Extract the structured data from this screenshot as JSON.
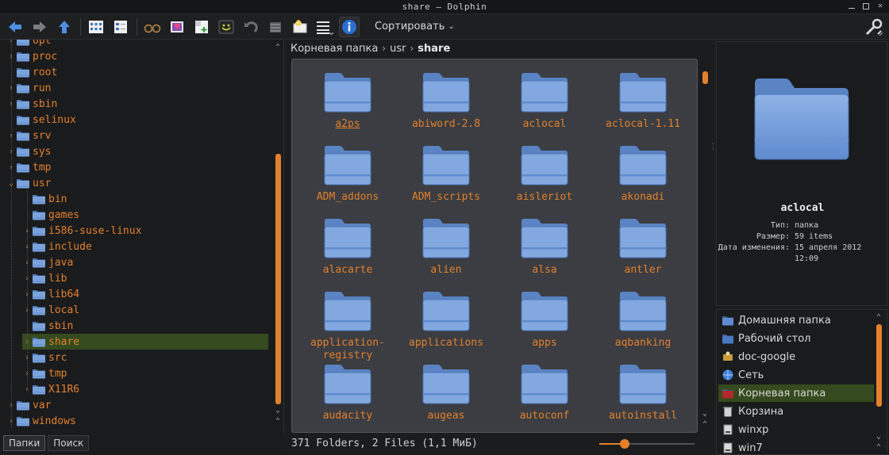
{
  "window": {
    "title": "share – Dolphin"
  },
  "toolbar": {
    "sort_label": "Сортировать"
  },
  "breadcrumb": {
    "root": "Корневая папка",
    "mid": "usr",
    "current": "share"
  },
  "tree": [
    {
      "label": "opt",
      "depth": 0,
      "exp": ">"
    },
    {
      "label": "proc",
      "depth": 0,
      "exp": ">"
    },
    {
      "label": "root",
      "depth": 0,
      "exp": ""
    },
    {
      "label": "run",
      "depth": 0,
      "exp": ">"
    },
    {
      "label": "sbin",
      "depth": 0,
      "exp": ">"
    },
    {
      "label": "selinux",
      "depth": 0,
      "exp": ""
    },
    {
      "label": "srv",
      "depth": 0,
      "exp": ">"
    },
    {
      "label": "sys",
      "depth": 0,
      "exp": ">"
    },
    {
      "label": "tmp",
      "depth": 0,
      "exp": ">"
    },
    {
      "label": "usr",
      "depth": 0,
      "exp": "v"
    },
    {
      "label": "bin",
      "depth": 1,
      "exp": ""
    },
    {
      "label": "games",
      "depth": 1,
      "exp": ""
    },
    {
      "label": "i586-suse-linux",
      "depth": 1,
      "exp": ">"
    },
    {
      "label": "include",
      "depth": 1,
      "exp": ">"
    },
    {
      "label": "java",
      "depth": 1,
      "exp": ">"
    },
    {
      "label": "lib",
      "depth": 1,
      "exp": ">"
    },
    {
      "label": "lib64",
      "depth": 1,
      "exp": ">"
    },
    {
      "label": "local",
      "depth": 1,
      "exp": ">"
    },
    {
      "label": "sbin",
      "depth": 1,
      "exp": ""
    },
    {
      "label": "share",
      "depth": 1,
      "exp": ">",
      "selected": true
    },
    {
      "label": "src",
      "depth": 1,
      "exp": ">"
    },
    {
      "label": "tmp",
      "depth": 1,
      "exp": ">"
    },
    {
      "label": "X11R6",
      "depth": 1,
      "exp": ">"
    },
    {
      "label": "var",
      "depth": 0,
      "exp": ">"
    },
    {
      "label": "windows",
      "depth": 0,
      "exp": ">"
    }
  ],
  "tabs": [
    {
      "label": "Папки",
      "active": true
    },
    {
      "label": "Поиск",
      "active": false
    }
  ],
  "files": [
    [
      "a2ps"
    ],
    [
      "abiword-2.8"
    ],
    [
      "aclocal"
    ],
    [
      "aclocal-1.11"
    ],
    [
      "ADM_addons"
    ],
    [
      "ADM_scripts"
    ],
    [
      "aisleriot"
    ],
    [
      "akonadi"
    ],
    [
      "alacarte"
    ],
    [
      "alien"
    ],
    [
      "alsa"
    ],
    [
      "antler"
    ],
    [
      "application-",
      "registry"
    ],
    [
      "applications"
    ],
    [
      "apps"
    ],
    [
      "aqbanking"
    ],
    [
      "audacity"
    ],
    [
      "augeas"
    ],
    [
      "autoconf"
    ],
    [
      "autoinstall"
    ]
  ],
  "status": {
    "text": "371 Folders, 2 Files (1,1 МиБ)",
    "zoom_fraction": 0.27
  },
  "info": {
    "name": "aclocal",
    "rows": [
      {
        "k": "Тип:",
        "v": "папка"
      },
      {
        "k": "Размер:",
        "v": "59 items"
      },
      {
        "k": "Дата изменения:",
        "v": "15 апреля 2012 12:09"
      }
    ]
  },
  "places": [
    {
      "label": "Домашняя папка",
      "icon": "home-folder-icon",
      "color": "#5f8bd1"
    },
    {
      "label": "Рабочий стол",
      "icon": "desktop-icon",
      "color": "#4a78c2"
    },
    {
      "label": "doc-google",
      "icon": "network-share-icon",
      "color": "#c79a3c"
    },
    {
      "label": "Сеть",
      "icon": "network-globe-icon",
      "color": "#3e7fd6"
    },
    {
      "label": "Корневая папка",
      "icon": "root-folder-icon",
      "color": "#b3262a",
      "selected": true
    },
    {
      "label": "Корзина",
      "icon": "trash-icon",
      "color": "#cfd2d6"
    },
    {
      "label": "winxp",
      "icon": "drive-icon",
      "color": "#d8d8d8"
    },
    {
      "label": "win7",
      "icon": "drive-icon",
      "color": "#d8d8d8"
    }
  ],
  "colors": {
    "accent": "#e2802c",
    "selection": "#354a1e",
    "folder": "#7aa3dc"
  }
}
